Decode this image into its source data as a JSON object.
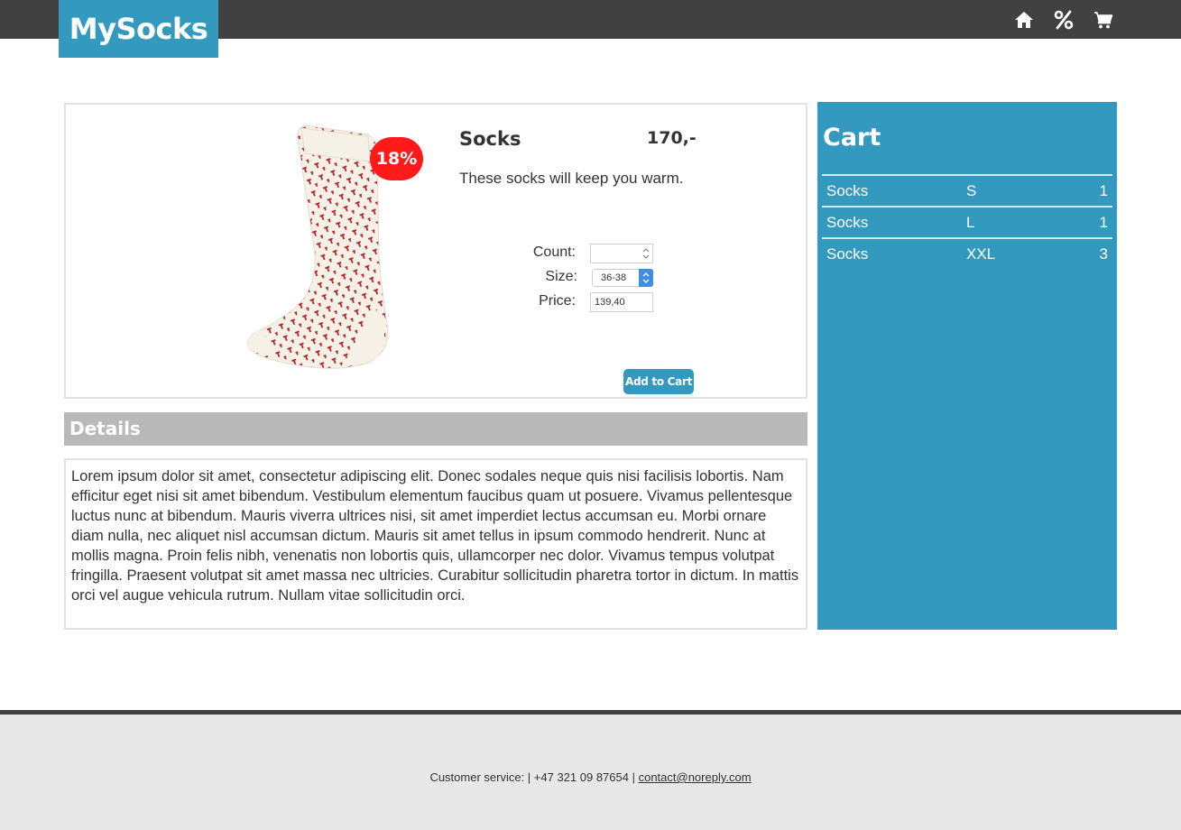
{
  "header": {
    "logo_text": "MySocks",
    "nav": [
      {
        "name": "home",
        "icon": "home-icon"
      },
      {
        "name": "offers",
        "icon": "percent-icon"
      },
      {
        "name": "cart",
        "icon": "shopping-cart-icon"
      }
    ]
  },
  "product": {
    "title": "Socks",
    "price": "170,-",
    "discount_badge": "18%",
    "description": "These socks will keep you warm.",
    "image_icon": "sock-image",
    "form": {
      "count_label": "Count:",
      "count_value": "",
      "size_label": "Size:",
      "size_value": "36-38",
      "price_label": "Price:",
      "price_value": "139,40"
    },
    "add_button": "Add to Cart"
  },
  "details": {
    "heading": "Details",
    "text": "Lorem ipsum dolor sit amet, consectetur adipiscing elit. Donec sodales neque quis nisi facilisis lobortis. Nam efficitur eget nisi sit amet bibendum. Vestibulum elementum faucibus quam ut posuere. Vivamus pellentesque luctus nunc at bibendum. Mauris viverra ultrices nisi, sit amet imperdiet lectus accumsan eu. Morbi ornare diam nulla, nec aliquet nisl accumsan dictum. Mauris sit amet tellus in ipsum commodo hendrerit. Nunc at mollis magna. Proin felis nibh, venenatis non lobortis quis, ullamcorper nec dolor. Vivamus tempus volutpat fringilla. Praesent volutpat sit amet massa nec ultricies. Curabitur sollicitudin pharetra tortor in dictum. In mattis orci vel augue vehicula rutrum. Nullam vitae sollicitudin orci."
  },
  "cart": {
    "title": "Cart",
    "items": [
      {
        "name": "Socks",
        "size": "S",
        "qty": "1"
      },
      {
        "name": "Socks",
        "size": "L",
        "qty": "1"
      },
      {
        "name": "Socks",
        "size": "XXL",
        "qty": "3"
      }
    ]
  },
  "footer": {
    "text": "Customer service: | +47 321 09 87654 |",
    "email": "contact@noreply.com"
  },
  "colors": {
    "topbar": "#414141",
    "accent": "#3399bf",
    "badge": "#ff1a1a",
    "details_header": "#b9b9b9",
    "footer_bg": "#e8e8e8"
  }
}
